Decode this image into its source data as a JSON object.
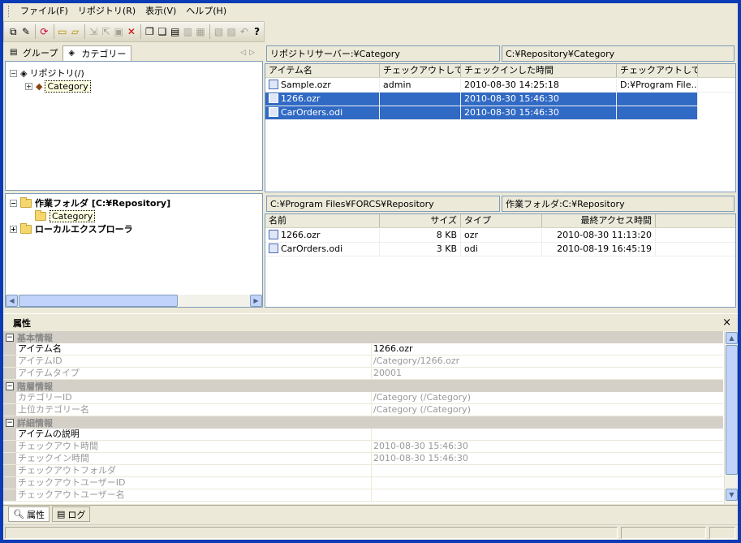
{
  "menu": [
    "ファイル(F)",
    "リポジトリ(R)",
    "表示(V)",
    "ヘルプ(H)"
  ],
  "toolbar": {
    "buttons": [
      "copy-icon",
      "edit-icon",
      "refresh-icon",
      "new-folder-icon",
      "open-folder-icon",
      "checkout-icon",
      "checkin-icon",
      "lock-icon",
      "delete-icon",
      "copy-item-icon",
      "move-item-icon",
      "properties-icon",
      "export-icon",
      "import-icon",
      "history-icon",
      "compare-icon",
      "undo-icon",
      "note-icon",
      "padlock-icon",
      "help-icon"
    ],
    "help_glyph": "?",
    "delete_glyph": "✕"
  },
  "left_tabs": {
    "group": "グループ",
    "category": "カテゴリー"
  },
  "repo_tree": {
    "root": "リポジトリ(/)",
    "child": "Category"
  },
  "repo_view": {
    "path_left": "リポジトリサーバー:¥Category",
    "path_right": "C:¥Repository¥Category",
    "columns": [
      "アイテム名",
      "チェックアウトして...",
      "チェックインした時間",
      "チェックアウトして..."
    ],
    "rows": [
      {
        "name": "Sample.ozr",
        "checkout_user": "admin",
        "checkin_time": "2010-08-30 14:25:18",
        "checkout_folder": "D:¥Program File...",
        "selected": false
      },
      {
        "name": "1266.ozr",
        "checkout_user": "",
        "checkin_time": "2010-08-30 15:46:30",
        "checkout_folder": "",
        "selected": true
      },
      {
        "name": "CarOrders.odi",
        "checkout_user": "",
        "checkin_time": "2010-08-30 15:46:30",
        "checkout_folder": "",
        "selected": true
      }
    ]
  },
  "work_tree": {
    "root": "作業フォルダ [C:¥Repository]",
    "child": "Category",
    "local": "ローカルエクスプローラ"
  },
  "local_view": {
    "path_left": "C:¥Program Files¥FORCS¥Repository",
    "path_right": "作業フォルダ:C:¥Repository",
    "columns": [
      "名前",
      "サイズ",
      "タイプ",
      "最終アクセス時間"
    ],
    "rows": [
      {
        "name": "1266.ozr",
        "size": "8 KB",
        "type": "ozr",
        "accessed": "2010-08-30 11:13:20"
      },
      {
        "name": "CarOrders.odi",
        "size": "3 KB",
        "type": "odi",
        "accessed": "2010-08-19 16:45:19"
      }
    ]
  },
  "properties": {
    "title": "属性",
    "close_glyph": "×",
    "sections": [
      {
        "name": "基本情報",
        "rows": [
          {
            "key": "アイテム名",
            "value": "1266.ozr",
            "dim": false
          },
          {
            "key": "アイテムID",
            "value": "/Category/1266.ozr",
            "dim": true
          },
          {
            "key": "アイテムタイプ",
            "value": "20001",
            "dim": true
          }
        ]
      },
      {
        "name": "階層情報",
        "rows": [
          {
            "key": "カテゴリーID",
            "value": "/Category (/Category)",
            "dim": true
          },
          {
            "key": "上位カテゴリー名",
            "value": "/Category (/Category)",
            "dim": true
          }
        ]
      },
      {
        "name": "詳細情報",
        "rows": [
          {
            "key": "アイテムの説明",
            "value": "",
            "dim": false
          },
          {
            "key": "チェックアウト時間",
            "value": "2010-08-30 15:46:30",
            "dim": true
          },
          {
            "key": "チェックイン時間",
            "value": "2010-08-30 15:46:30",
            "dim": true
          },
          {
            "key": "チェックアウトフォルダ",
            "value": "",
            "dim": true
          },
          {
            "key": "チェックアウトユーザーID",
            "value": "",
            "dim": true
          },
          {
            "key": "チェックアウトユーザー名",
            "value": "",
            "dim": true
          }
        ]
      }
    ]
  },
  "bottom_tabs": {
    "properties": "属性",
    "log": "ログ"
  },
  "colors": {
    "selection": "#316ac5",
    "titlebar": "#0b3bb5",
    "face": "#ece9d8"
  }
}
